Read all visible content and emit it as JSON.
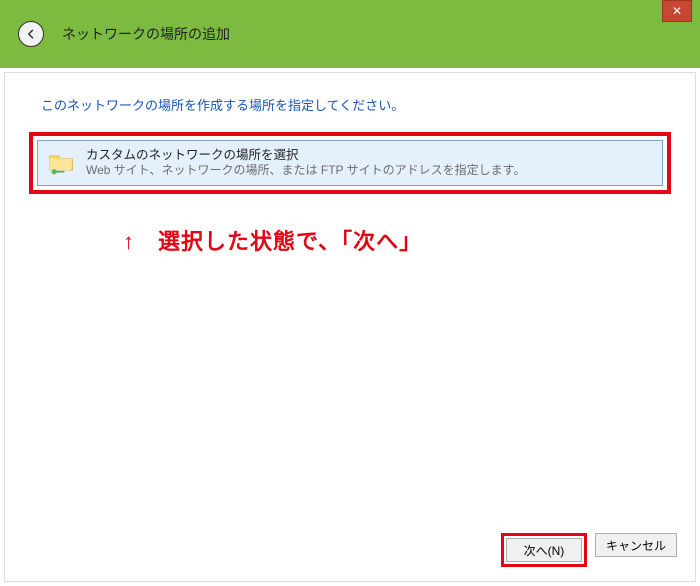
{
  "titlebar": {
    "title": "ネットワークの場所の追加"
  },
  "content": {
    "instruction": "このネットワークの場所を作成する場所を指定してください。",
    "option": {
      "title": "カスタムのネットワークの場所を選択",
      "description": "Web サイト、ネットワークの場所、または FTP サイトのアドレスを指定します。"
    }
  },
  "annotation": {
    "text": "↑　選択した状態で、「次へ」"
  },
  "footer": {
    "next": "次へ(N)",
    "cancel": "キャンセル"
  }
}
